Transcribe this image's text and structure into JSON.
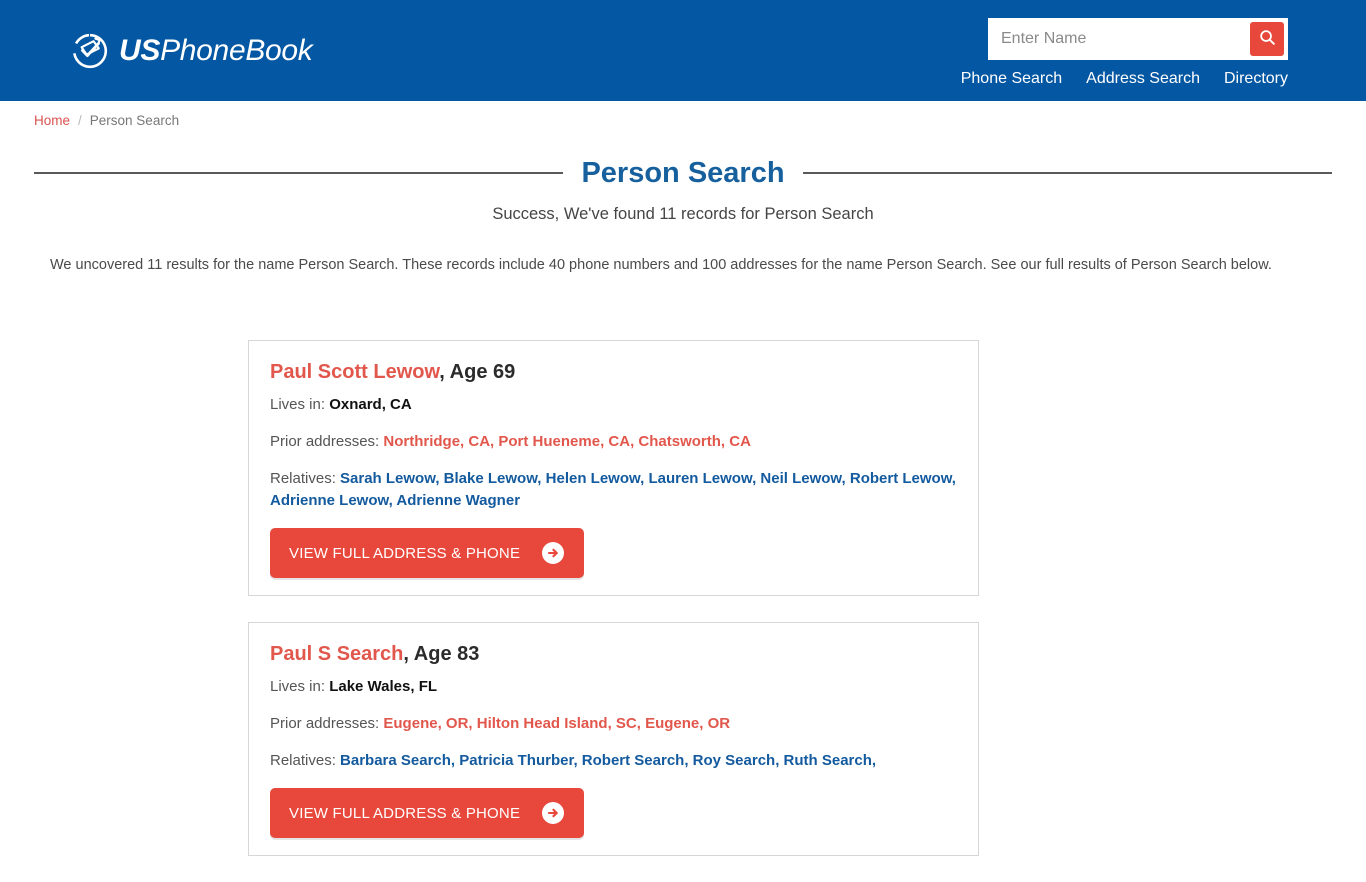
{
  "header": {
    "logo": {
      "icon": "usphonebook-check-circle-icon",
      "text_bold": "US",
      "text_normal": "PhoneBook"
    },
    "search": {
      "placeholder": "Enter Name",
      "value": "",
      "button_icon": "search-icon"
    },
    "nav": [
      {
        "label": "Phone Search"
      },
      {
        "label": "Address Search"
      },
      {
        "label": "Directory"
      }
    ],
    "background_color": "#0457a2"
  },
  "breadcrumb": {
    "home": "Home",
    "separator": "/",
    "current": "Person Search"
  },
  "page": {
    "title": "Person Search",
    "subtitle": "Success, We've found 11 records for Person Search",
    "description": "We uncovered 11 results for the name Person Search. These records include 40 phone numbers and 100 addresses for the name Person Search. See our full results of Person Search below.",
    "title_color": "#17609e",
    "accent_color": "#e2574c",
    "link_color": "#135a9e"
  },
  "labels": {
    "lives_in": "Lives in: ",
    "prior_addresses": "Prior addresses: ",
    "relatives": "Relatives: ",
    "cta": "VIEW FULL ADDRESS & PHONE"
  },
  "results": [
    {
      "name": "Paul Scott Lewow",
      "age": ", Age 69",
      "lives_in": "Oxnard, CA",
      "prior_addresses": "Northridge, CA, Port Hueneme, CA, Chatsworth, CA",
      "relatives": "Sarah Lewow, Blake Lewow, Helen Lewow, Lauren Lewow, Neil Lewow, Robert Lewow, Adrienne Lewow, Adrienne Wagner",
      "cta": "VIEW FULL ADDRESS & PHONE"
    },
    {
      "name": "Paul S Search",
      "age": ", Age 83",
      "lives_in": "Lake Wales, FL",
      "prior_addresses": "Eugene, OR, Hilton Head Island, SC, Eugene, OR",
      "relatives": "Barbara Search, Patricia Thurber, Robert Search, Roy Search, Ruth Search,",
      "cta": "VIEW FULL ADDRESS & PHONE"
    }
  ]
}
